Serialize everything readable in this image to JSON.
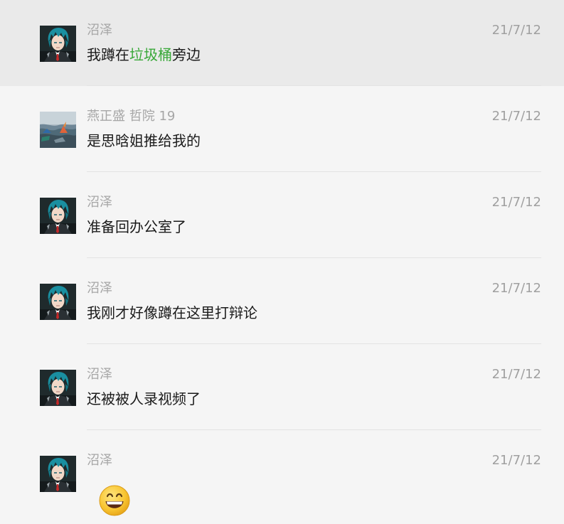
{
  "messages": [
    {
      "sender": "沼泽",
      "date": "21/7/12",
      "avatar_icon": "anime-character-avatar-icon",
      "text_before": "我蹲在",
      "text_highlight": "垃圾桶",
      "text_after": "旁边",
      "highlight_color": "#38a838",
      "selected": true
    },
    {
      "sender": "燕正盛 哲院 19",
      "date": "21/7/12",
      "avatar_icon": "landscape-photo-avatar-icon",
      "text": "是思晗姐推给我的"
    },
    {
      "sender": "沼泽",
      "date": "21/7/12",
      "avatar_icon": "anime-character-avatar-icon",
      "text": "准备回办公室了"
    },
    {
      "sender": "沼泽",
      "date": "21/7/12",
      "avatar_icon": "anime-character-avatar-icon",
      "text": "我刚才好像蹲在这里打辩论"
    },
    {
      "sender": "沼泽",
      "date": "21/7/12",
      "avatar_icon": "anime-character-avatar-icon",
      "text": "还被被人录视频了"
    },
    {
      "sender": "沼泽",
      "date": "21/7/12",
      "avatar_icon": "anime-character-avatar-icon",
      "emoji_icon": "grinning-face-emoji-icon"
    }
  ],
  "colors": {
    "background": "#f5f5f5",
    "selected_background": "#eaeaea",
    "name_text": "#a6a6a6",
    "date_text": "#a0a0a0",
    "message_text": "#1a1a1a",
    "divider": "#e3e3e3"
  }
}
